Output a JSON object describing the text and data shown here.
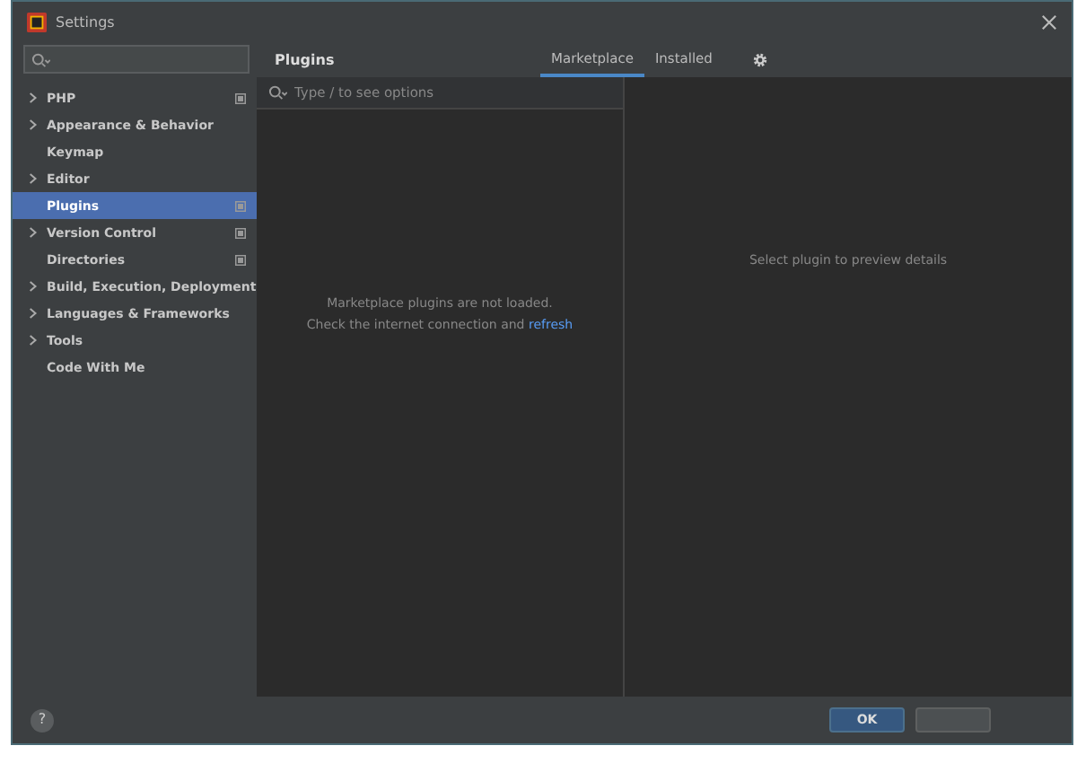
{
  "window": {
    "title": "Settings"
  },
  "sidebar": {
    "items": [
      {
        "label": "PHP",
        "expandable": true,
        "selected": false,
        "project_icon": true
      },
      {
        "label": "Appearance & Behavior",
        "expandable": true,
        "selected": false,
        "project_icon": false
      },
      {
        "label": "Keymap",
        "expandable": false,
        "selected": false,
        "project_icon": false
      },
      {
        "label": "Editor",
        "expandable": true,
        "selected": false,
        "project_icon": false
      },
      {
        "label": "Plugins",
        "expandable": false,
        "selected": true,
        "project_icon": true
      },
      {
        "label": "Version Control",
        "expandable": true,
        "selected": false,
        "project_icon": true
      },
      {
        "label": "Directories",
        "expandable": false,
        "selected": false,
        "project_icon": true
      },
      {
        "label": "Build, Execution, Deployment",
        "expandable": true,
        "selected": false,
        "project_icon": false
      },
      {
        "label": "Languages & Frameworks",
        "expandable": true,
        "selected": false,
        "project_icon": false
      },
      {
        "label": "Tools",
        "expandable": true,
        "selected": false,
        "project_icon": false
      },
      {
        "label": "Code With Me",
        "expandable": false,
        "selected": false,
        "project_icon": false
      }
    ]
  },
  "page": {
    "title": "Plugins",
    "tabs": [
      {
        "label": "Marketplace",
        "selected": true
      },
      {
        "label": "Installed",
        "selected": false
      }
    ],
    "search": {
      "placeholder": "Type / to see options"
    },
    "empty_message": {
      "line_1": "Marketplace plugins are not loaded.",
      "line_2": "Check the internet connection and",
      "link": "refresh"
    },
    "details_hint": "Select plugin to preview details"
  },
  "help": "?",
  "buttons": [
    {
      "label": "OK",
      "kind": "primary"
    },
    {
      "kind": "plain"
    }
  ]
}
